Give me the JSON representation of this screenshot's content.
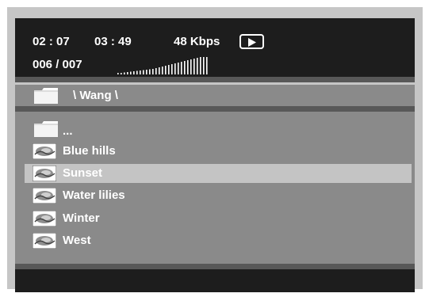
{
  "status": {
    "elapsed_time": "02 : 07",
    "total_time": "03 : 49",
    "bitrate": "48 Kbps",
    "play_state": "play-icon",
    "track_counter": "006 / 007",
    "volume_icon": "volume-level-icon"
  },
  "path": {
    "folder_icon": "folder-icon",
    "current_path": "\\ Wang \\"
  },
  "file_list": {
    "items": [
      {
        "label": "...",
        "icon": "folder-icon",
        "selected": false
      },
      {
        "label": "Blue hills",
        "icon": "image-file-icon",
        "selected": false
      },
      {
        "label": "Sunset",
        "icon": "image-file-icon",
        "selected": true
      },
      {
        "label": "Water lilies",
        "icon": "image-file-icon",
        "selected": false
      },
      {
        "label": "Winter",
        "icon": "image-file-icon",
        "selected": false
      },
      {
        "label": "West",
        "icon": "image-file-icon",
        "selected": false
      }
    ]
  },
  "colors": {
    "header_bg": "#1d1d1d",
    "panel_bg": "#8a8a8a",
    "selection_bg": "#c4c4c4",
    "text": "#ffffff"
  }
}
